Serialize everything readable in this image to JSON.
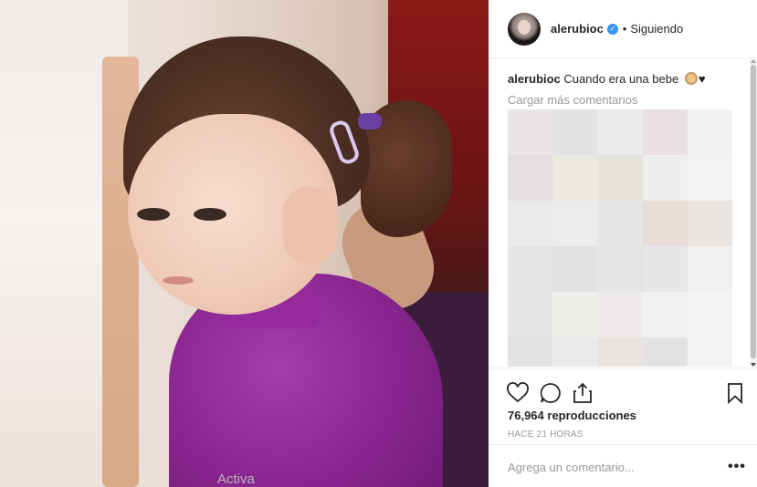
{
  "post": {
    "username": "alerubioc",
    "separator": "•",
    "follow_status": "Siguiendo",
    "verified_icon": "check-icon"
  },
  "caption": {
    "username": "alerubioc",
    "text": "Cuando era una bebe",
    "emojis": [
      "baby-face-icon",
      "black-heart-icon"
    ]
  },
  "comments": {
    "load_more_label": "Cargar más comentarios",
    "mosaic_colors": [
      "#eae6e6",
      "#e3e2e3",
      "#ecebec",
      "#e8e0e2",
      "#f3f2f3",
      "#e3dfe1",
      "#ebe9e0",
      "#e7e5d9",
      "#eeedef",
      "#f3f3f3",
      "#ebe9ea",
      "#edebec",
      "#e6e5e7",
      "#e8ddd6",
      "#eae4e1",
      "#e6e4e6",
      "#e3e0e1",
      "#e5e4e6",
      "#e7e6e8",
      "#f1f1f2",
      "#e6e6e7",
      "#ededea",
      "#eeeaea",
      "#f2f1f2",
      "#f4f4f5",
      "#e3e3e3",
      "#ebeaea",
      "#e7e4e2",
      "#e5e2e3",
      "#f3f3f3"
    ]
  },
  "actions": {
    "views_count": "76,964",
    "views_label": "reproducciones",
    "timestamp": "HACE 21 HORAS"
  },
  "add_comment": {
    "placeholder": "Agrega un comentario...",
    "more_label": "•••"
  },
  "watermark": "Activa",
  "colors": {
    "verified": "#3897f0",
    "muted_text": "#999999",
    "border": "#efefef"
  }
}
